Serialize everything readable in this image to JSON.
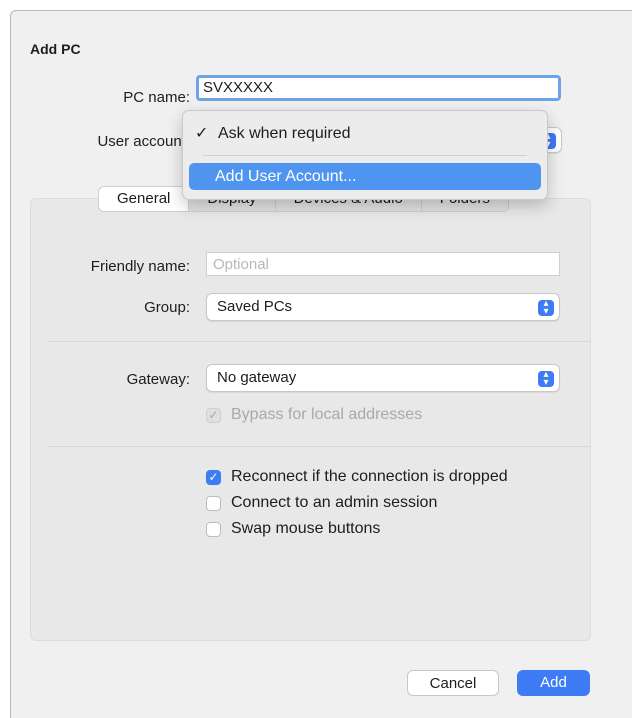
{
  "dialog": {
    "title": "Add PC"
  },
  "pc_name": {
    "label": "PC name:",
    "value": "SVXXXXX"
  },
  "user_account": {
    "label": "User account:",
    "menu_items": [
      {
        "label": "Ask when required",
        "checked": true,
        "check_glyph": "✓"
      },
      {
        "label": "Add User Account...",
        "highlighted": true
      }
    ]
  },
  "tabs": [
    {
      "label": "General",
      "selected": true
    },
    {
      "label": "Display"
    },
    {
      "label": "Devices & Audio"
    },
    {
      "label": "Folders"
    }
  ],
  "general": {
    "friendly_name": {
      "label": "Friendly name:",
      "placeholder": "Optional",
      "value": ""
    },
    "group": {
      "label": "Group:",
      "value": "Saved PCs"
    },
    "gateway": {
      "label": "Gateway:",
      "value": "No gateway"
    },
    "bypass": {
      "label": "Bypass for local addresses",
      "checked": true,
      "disabled": true
    },
    "reconnect": {
      "label": "Reconnect if the connection is dropped",
      "checked": true
    },
    "admin_session": {
      "label": "Connect to an admin session",
      "checked": false
    },
    "swap_mouse": {
      "label": "Swap mouse buttons",
      "checked": false
    }
  },
  "footer": {
    "cancel_label": "Cancel",
    "add_label": "Add"
  },
  "colors": {
    "accent": "#3d7cf5",
    "menu_highlight": "#4f95ef",
    "focus_ring": "#6ea3e6"
  },
  "icons": {
    "checkmark": "checkmark-icon",
    "popup_stepper": "chevron-up-down-icon"
  }
}
